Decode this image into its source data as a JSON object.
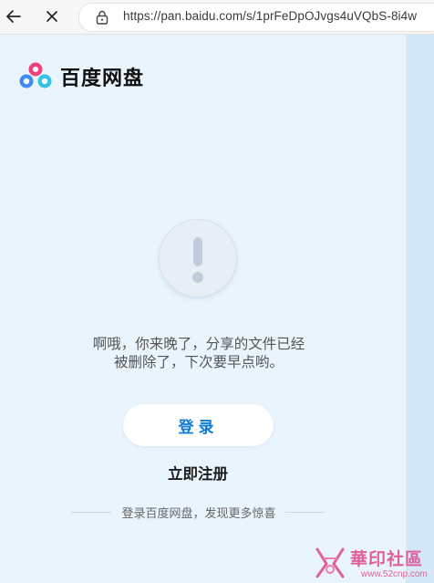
{
  "browser": {
    "url": "https://pan.baidu.com/s/1prFeDpOJvgs4uVQbS-8i4w"
  },
  "brand": {
    "name": "百度网盘"
  },
  "message": {
    "line1": "啊哦，你来晚了，分享的文件已经",
    "line2": "被删除了，下次要早点哟。"
  },
  "actions": {
    "login_label": "登录",
    "register_label": "立即注册"
  },
  "tip": "登录百度网盘，发现更多惊喜",
  "watermark": {
    "text": "華印社區",
    "url": "www.52cnp.com"
  },
  "colors": {
    "background": "#e9f4fd",
    "accent": "#0b7bd9",
    "watermark": "#e0609a"
  }
}
